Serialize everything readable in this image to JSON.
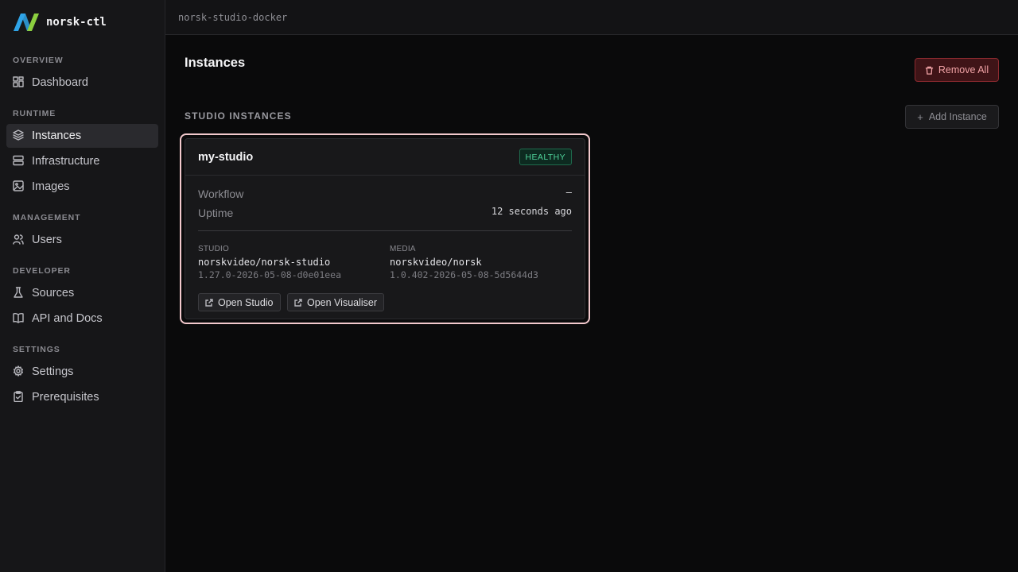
{
  "app": {
    "name": "norsk-ctl",
    "colors": {
      "logo_blue": "#2fa4e7",
      "logo_green": "#8ccf3f",
      "accent_danger": "#8c2a2f",
      "healthy": "#4fd39a"
    }
  },
  "sidebar": {
    "sections": [
      {
        "title": "OVERVIEW",
        "items": [
          {
            "label": "Dashboard",
            "icon": "dashboard-icon"
          }
        ]
      },
      {
        "title": "RUNTIME",
        "items": [
          {
            "label": "Instances",
            "icon": "layers-icon",
            "active": true
          },
          {
            "label": "Infrastructure",
            "icon": "server-icon"
          },
          {
            "label": "Images",
            "icon": "image-icon"
          }
        ]
      },
      {
        "title": "MANAGEMENT",
        "items": [
          {
            "label": "Users",
            "icon": "users-icon"
          }
        ]
      },
      {
        "title": "DEVELOPER",
        "items": [
          {
            "label": "Sources",
            "icon": "flask-icon"
          },
          {
            "label": "API and Docs",
            "icon": "book-icon"
          }
        ]
      },
      {
        "title": "SETTINGS",
        "items": [
          {
            "label": "Settings",
            "icon": "gear-icon"
          },
          {
            "label": "Prerequisites",
            "icon": "clipboard-check-icon"
          }
        ]
      }
    ]
  },
  "topbar": {
    "breadcrumb": "norsk-studio-docker"
  },
  "main": {
    "title": "Instances",
    "remove_all_label": "Remove All",
    "section_title": "STUDIO INSTANCES",
    "add_instance_label": "Add Instance"
  },
  "instance": {
    "name": "my-studio",
    "status": "HEALTHY",
    "workflow_label": "Workflow",
    "workflow_value": "–",
    "uptime_label": "Uptime",
    "uptime_value": "12 seconds ago",
    "studio": {
      "label": "STUDIO",
      "image": "norskvideo/norsk-studio",
      "version": "1.27.0-2026-05-08-d0e01eea"
    },
    "media": {
      "label": "MEDIA",
      "image": "norskvideo/norsk",
      "version": "1.0.402-2026-05-08-5d5644d3"
    },
    "open_studio_label": "Open Studio",
    "open_visualiser_label": "Open Visualiser"
  }
}
